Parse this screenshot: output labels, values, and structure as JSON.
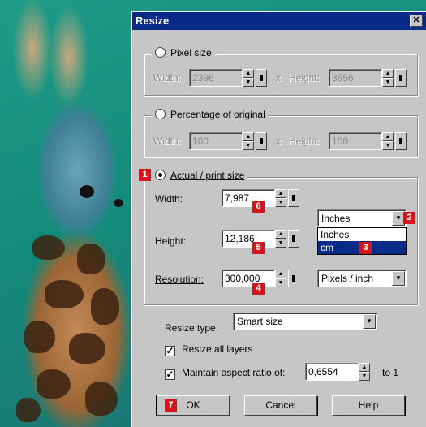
{
  "dialog": {
    "title": "Resize",
    "close_glyph": "✕"
  },
  "pixel_size": {
    "label": "Pixel size",
    "width_label": "Width:",
    "width_value": "2396",
    "x_sep": "x",
    "height_label": "Height:",
    "height_value": "3656"
  },
  "percentage": {
    "label": "Percentage of original",
    "width_label": "Width:",
    "width_value": "100",
    "x_sep": "x",
    "height_label": "Height:",
    "height_value": "100"
  },
  "actual_print": {
    "label": "Actual / print size",
    "width_label": "Width:",
    "width_value": "7,987",
    "height_label": "Height:",
    "height_value": "12,186",
    "resolution_label": "Resolution:",
    "resolution_value": "300,000",
    "unit_selected": "Inches",
    "unit_options": [
      "Inches",
      "cm"
    ],
    "unit_highlighted": "cm",
    "resolution_unit": "Pixels / inch"
  },
  "resize_type": {
    "label": "Resize type:",
    "value": "Smart size"
  },
  "options": {
    "resize_all_layers": "Resize all layers",
    "maintain_aspect": "Maintain aspect ratio of:",
    "aspect_value": "0,6554",
    "to_one": "to 1"
  },
  "buttons": {
    "ok": "OK",
    "cancel": "Cancel",
    "help": "Help"
  },
  "callouts": {
    "c1": "1",
    "c2": "2",
    "c3": "3",
    "c4": "4",
    "c5": "5",
    "c6": "6",
    "c7": "7"
  },
  "colors": {
    "titlebar": "#0a2a8a",
    "dialog_bg": "#c6c6c6",
    "callout": "#d7141b"
  },
  "icons": {
    "close": "close-icon",
    "dropdown": "chevron-down-icon",
    "spinner": "spin-arrows-icon",
    "check": "check-icon"
  }
}
